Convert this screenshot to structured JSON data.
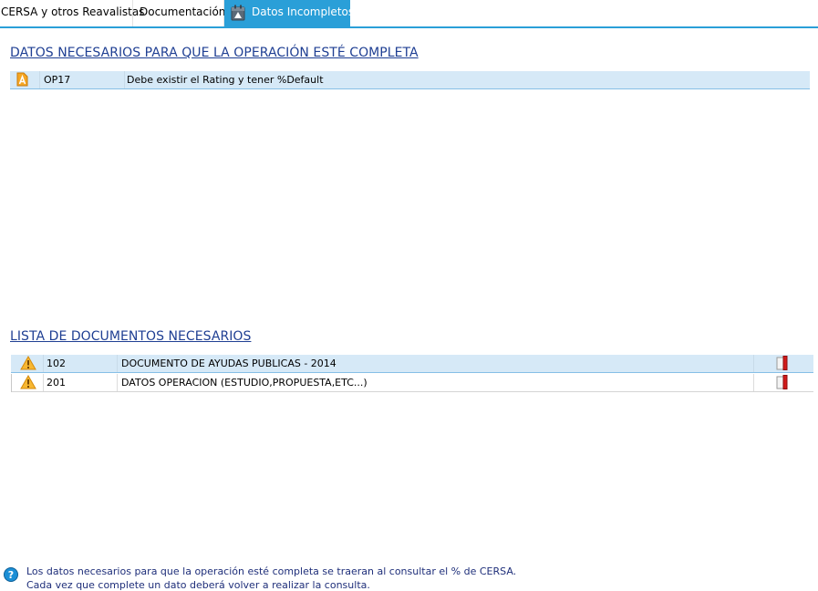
{
  "tabs": [
    {
      "label": "CERSA y otros Reavalistas",
      "active": false
    },
    {
      "label": "Documentación",
      "active": false
    },
    {
      "label": "Datos Incompletos",
      "active": true,
      "icon": "calendar-warning-icon"
    }
  ],
  "section1": {
    "title": "DATOS NECESARIOS PARA QUE LA OPERACIÓN ESTÉ COMPLETA",
    "rows": [
      {
        "icon": "alert-a-icon",
        "code": "OP17",
        "description": "Debe existir el Rating y tener %Default"
      }
    ]
  },
  "section2": {
    "title": "LISTA DE DOCUMENTOS NECESARIOS",
    "rows": [
      {
        "icon": "warning-icon",
        "code": "102",
        "description": "DOCUMENTO DE AYUDAS  PUBLICAS - 2014",
        "action_icon": "document-red-icon"
      },
      {
        "icon": "warning-icon",
        "code": "201",
        "description": "DATOS OPERACION (ESTUDIO,PROPUESTA,ETC...)",
        "action_icon": "document-red-icon"
      }
    ]
  },
  "footer": {
    "icon": "help-icon",
    "line1": "Los datos necesarios para que la operación esté completa se traeran al consultar el % de CERSA.",
    "line2": "Cada vez que complete un dato deberá volver a realizar la consulta."
  },
  "colors": {
    "accent": "#2a9fd8",
    "title": "#1f3f93",
    "selected_row": "#d6e9f7"
  }
}
